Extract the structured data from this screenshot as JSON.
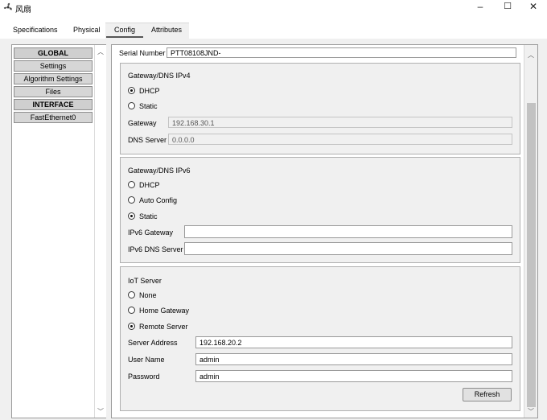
{
  "window": {
    "title": "风扇",
    "minimize": "–",
    "maximize": "☐",
    "close": "✕"
  },
  "tabs": [
    {
      "label": "Specifications"
    },
    {
      "label": "Physical"
    },
    {
      "label": "Config"
    },
    {
      "label": "Attributes"
    }
  ],
  "sidebar": {
    "items": [
      {
        "label": "GLOBAL"
      },
      {
        "label": "Settings"
      },
      {
        "label": "Algorithm Settings"
      },
      {
        "label": "Files"
      },
      {
        "label": "INTERFACE"
      },
      {
        "label": "FastEthernet0"
      }
    ]
  },
  "serial": {
    "label": "Serial Number",
    "value": "PTT08108JND-"
  },
  "ipv4": {
    "title": "Gateway/DNS IPv4",
    "dhcp": "DHCP",
    "static": "Static",
    "selected": "DHCP",
    "gateway_label": "Gateway",
    "gateway_value": "192.168.30.1",
    "dns_label": "DNS Server",
    "dns_value": "0.0.0.0"
  },
  "ipv6": {
    "title": "Gateway/DNS IPv6",
    "dhcp": "DHCP",
    "auto": "Auto Config",
    "static": "Static",
    "selected": "Static",
    "gateway_label": "IPv6 Gateway",
    "gateway_value": "",
    "dns_label": "IPv6 DNS Server",
    "dns_value": ""
  },
  "iot": {
    "title": "IoT Server",
    "none": "None",
    "home": "Home Gateway",
    "remote": "Remote Server",
    "selected": "Remote Server",
    "address_label": "Server Address",
    "address_value": "192.168.20.2",
    "user_label": "User Name",
    "user_value": "admin",
    "password_label": "Password",
    "password_value": "admin",
    "refresh": "Refresh"
  }
}
